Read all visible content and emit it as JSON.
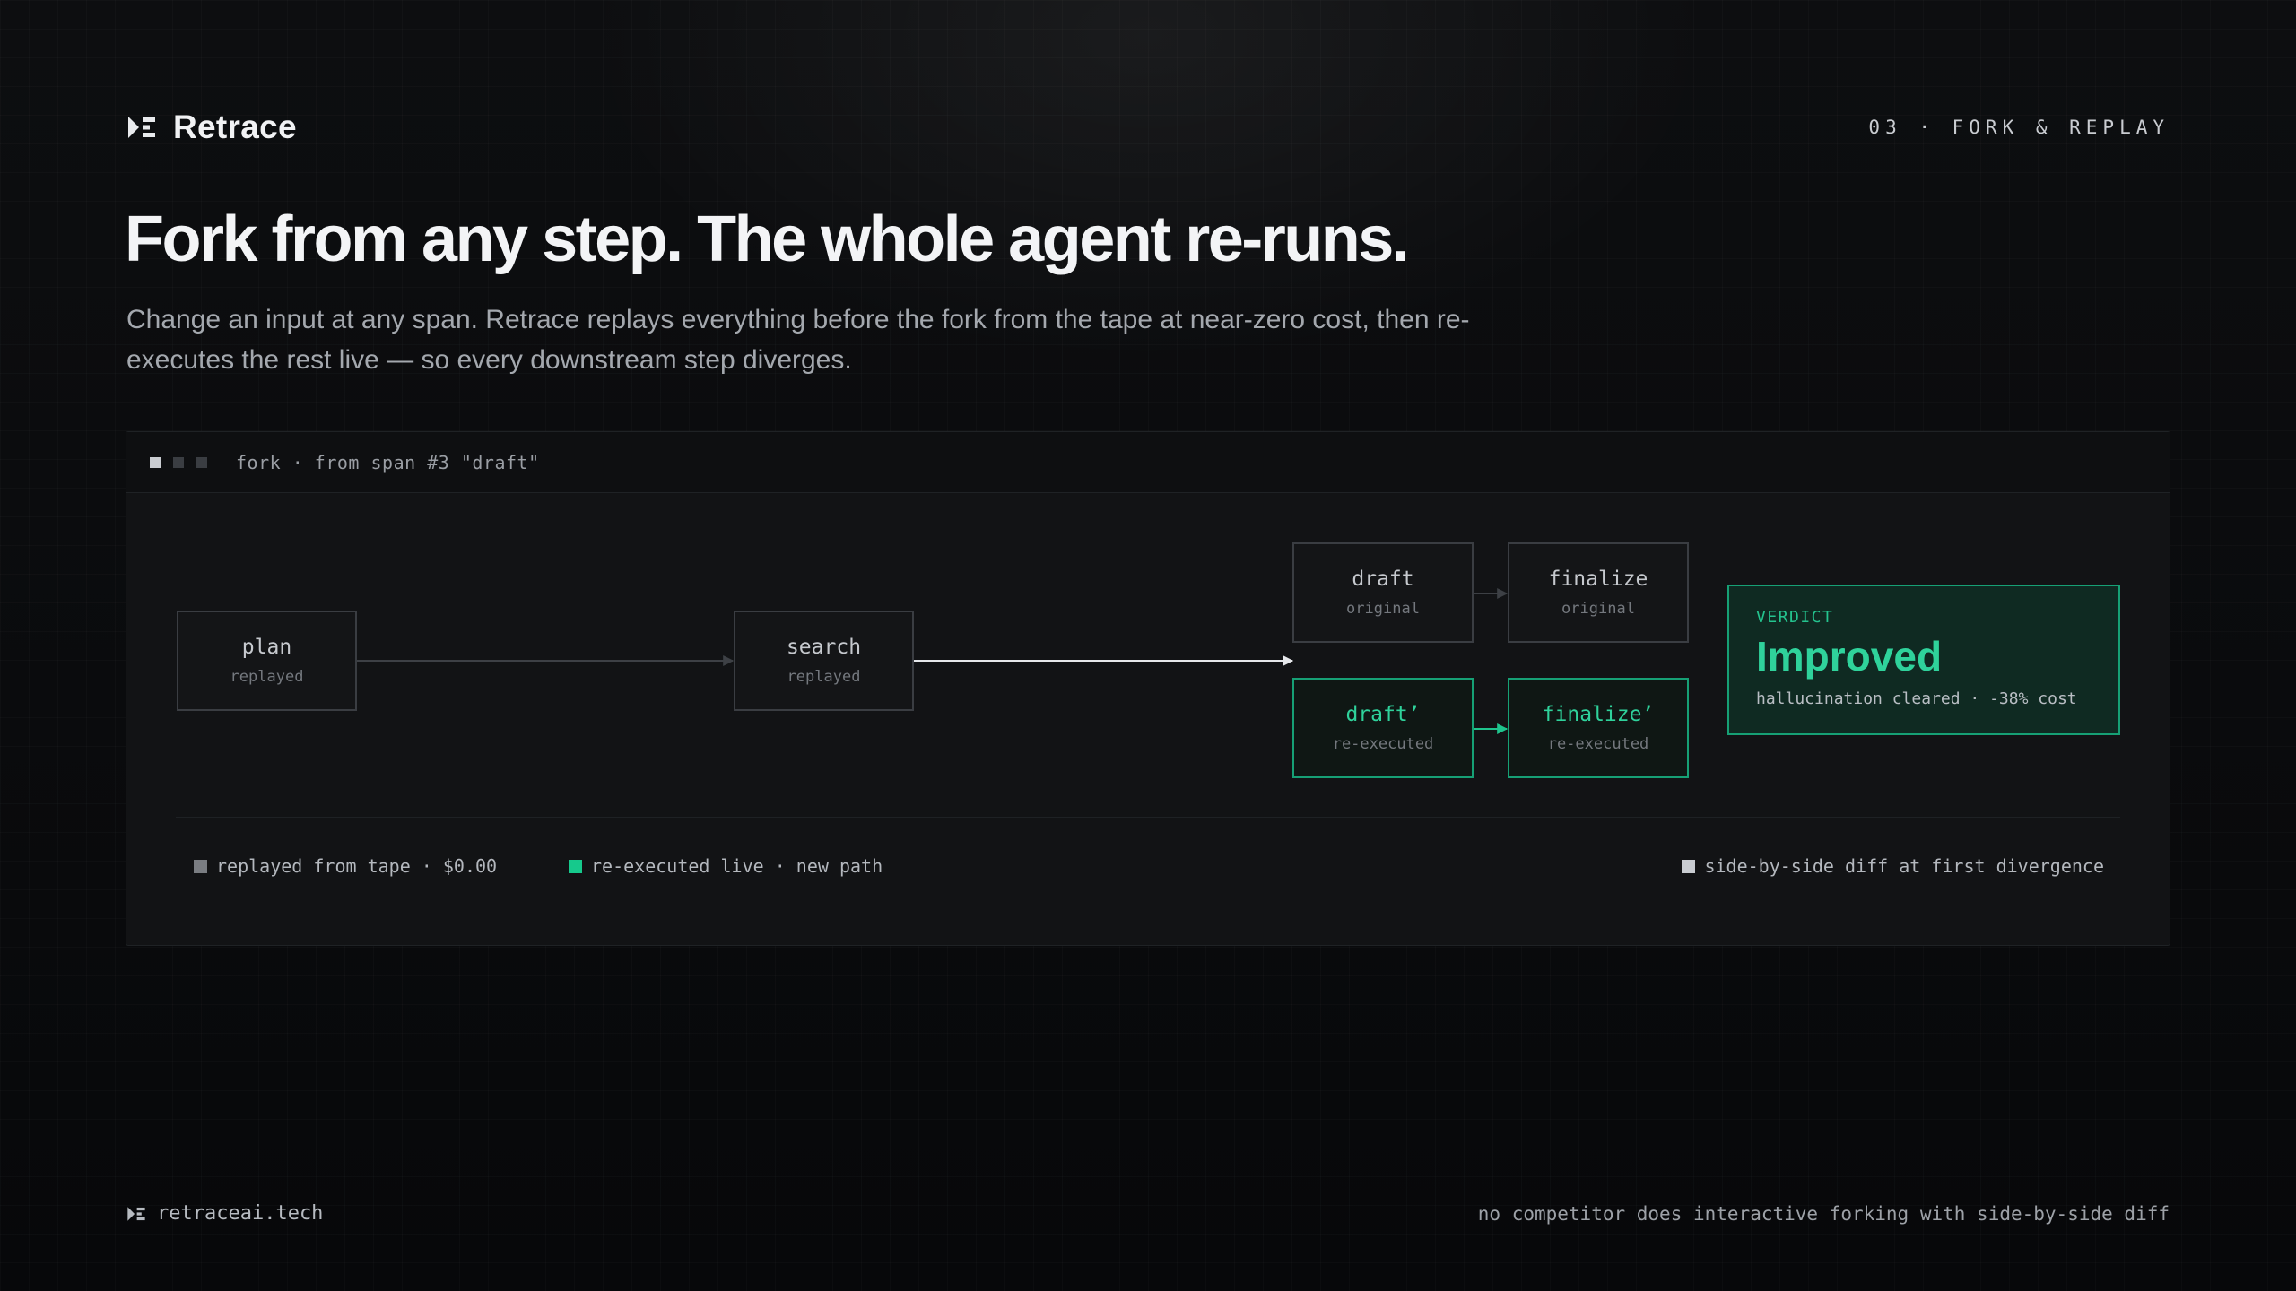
{
  "brand": {
    "name": "Retrace",
    "logo_icon": "retrace-logo-icon"
  },
  "section": {
    "label": "03 · FORK & REPLAY"
  },
  "hero": {
    "title": "Fork from any step. The whole agent re-runs.",
    "subtitle": "Change an input at any span. Retrace replays everything before the fork from the tape at near-zero cost, then re-executes the rest live — so every downstream step diverges."
  },
  "window": {
    "title": "fork · from span #3 \"draft\"",
    "dot_colors": [
      "#c9ccd1",
      "#3a3d42",
      "#3a3d42"
    ]
  },
  "nodes": {
    "plan": {
      "title": "plan",
      "sub": "replayed"
    },
    "search": {
      "title": "search",
      "sub": "replayed"
    },
    "draft": {
      "title": "draft",
      "sub": "original"
    },
    "finalize": {
      "title": "finalize",
      "sub": "original"
    },
    "draft_new": {
      "title": "draft’",
      "sub": "re-executed"
    },
    "finalize_new": {
      "title": "finalize’",
      "sub": "re-executed"
    }
  },
  "verdict": {
    "label": "VERDICT",
    "value": "Improved",
    "note": "hallucination cleared · -38% cost"
  },
  "legend": {
    "replayed": {
      "label": "replayed from tape · $0.00",
      "color": "#7a7d82"
    },
    "reexecuted": {
      "label": "re-executed live · new path",
      "color": "#16c98c"
    },
    "diff": {
      "label": "side-by-side diff at first divergence",
      "color": "#c9ccd1"
    }
  },
  "colors": {
    "accent": "#2fd29b",
    "accent_border": "#16a075",
    "background": "#0a0b0c"
  },
  "footer": {
    "site": "retraceai.tech",
    "note": "no competitor does interactive forking with side-by-side diff"
  }
}
